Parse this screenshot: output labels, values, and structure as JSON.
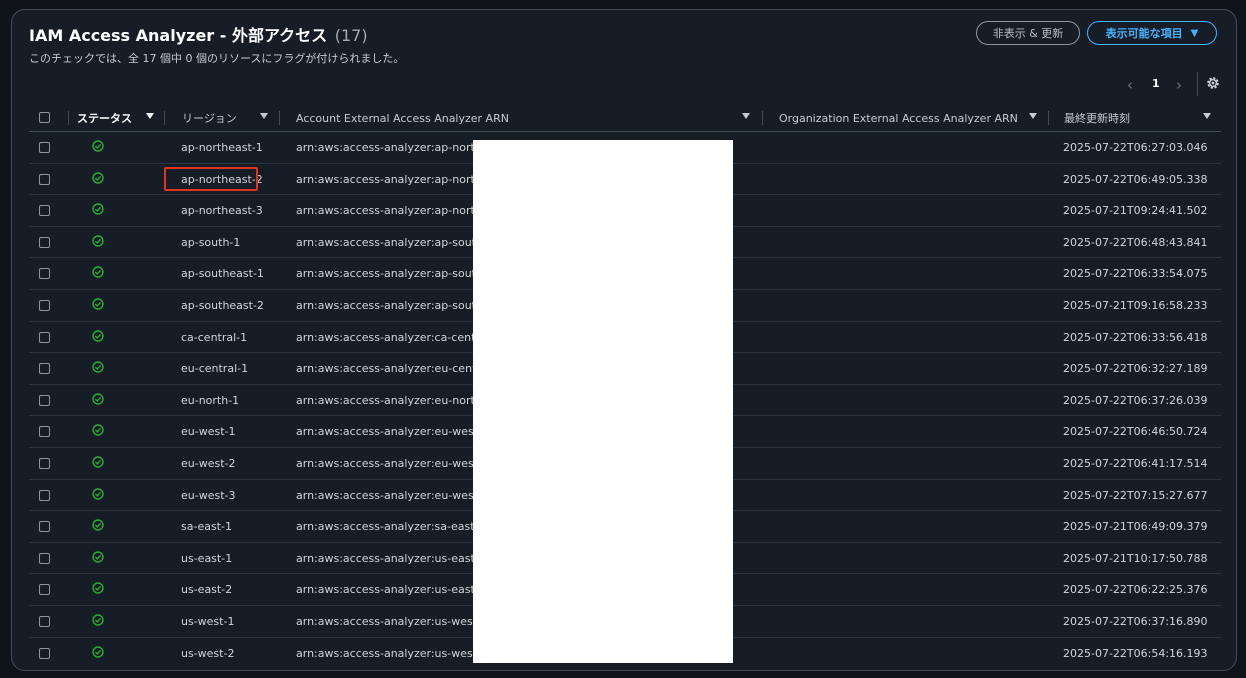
{
  "header": {
    "title": "IAM Access Analyzer - 外部アクセス",
    "count": "(17)",
    "subtitle": "このチェックでは、全 17 個中 0 個のリソースにフラグが付けられました。",
    "hide_button": "非表示 & 更新",
    "show_button": "表示可能な項目"
  },
  "pagination": {
    "current_page": "1"
  },
  "columns": {
    "status": "ステータス",
    "region": "リージョン",
    "account_arn": "Account External Access Analyzer ARN",
    "org_arn": "Organization External Access Analyzer ARN",
    "updated": "最終更新時刻"
  },
  "rows": [
    {
      "region": "ap-northeast-1",
      "arn": "arn:aws:access-analyzer:ap-northeast-1:",
      "updated": "2025-07-22T06:27:03.046"
    },
    {
      "region": "ap-northeast-2",
      "arn": "arn:aws:access-analyzer:ap-northeast-2:",
      "updated": "2025-07-22T06:49:05.338"
    },
    {
      "region": "ap-northeast-3",
      "arn": "arn:aws:access-analyzer:ap-northeast-3:",
      "updated": "2025-07-21T09:24:41.502"
    },
    {
      "region": "ap-south-1",
      "arn": "arn:aws:access-analyzer:ap-south-1:",
      "updated": "2025-07-22T06:48:43.841"
    },
    {
      "region": "ap-southeast-1",
      "arn": "arn:aws:access-analyzer:ap-southeast-1:",
      "updated": "2025-07-22T06:33:54.075"
    },
    {
      "region": "ap-southeast-2",
      "arn": "arn:aws:access-analyzer:ap-southeast-2:",
      "updated": "2025-07-21T09:16:58.233"
    },
    {
      "region": "ca-central-1",
      "arn": "arn:aws:access-analyzer:ca-central-1:",
      "updated": "2025-07-22T06:33:56.418"
    },
    {
      "region": "eu-central-1",
      "arn": "arn:aws:access-analyzer:eu-central-1:",
      "updated": "2025-07-22T06:32:27.189"
    },
    {
      "region": "eu-north-1",
      "arn": "arn:aws:access-analyzer:eu-north-1:",
      "updated": "2025-07-22T06:37:26.039"
    },
    {
      "region": "eu-west-1",
      "arn": "arn:aws:access-analyzer:eu-west-1:",
      "updated": "2025-07-22T06:46:50.724"
    },
    {
      "region": "eu-west-2",
      "arn": "arn:aws:access-analyzer:eu-west-2:",
      "updated": "2025-07-22T06:41:17.514"
    },
    {
      "region": "eu-west-3",
      "arn": "arn:aws:access-analyzer:eu-west-3:",
      "updated": "2025-07-22T07:15:27.677"
    },
    {
      "region": "sa-east-1",
      "arn": "arn:aws:access-analyzer:sa-east-1:1",
      "updated": "2025-07-21T06:49:09.379"
    },
    {
      "region": "us-east-1",
      "arn": "arn:aws:access-analyzer:us-east-1:1",
      "updated": "2025-07-21T10:17:50.788"
    },
    {
      "region": "us-east-2",
      "arn": "arn:aws:access-analyzer:us-east-2:1",
      "updated": "2025-07-22T06:22:25.376"
    },
    {
      "region": "us-west-1",
      "arn": "arn:aws:access-analyzer:us-west-1:",
      "updated": "2025-07-22T06:37:16.890"
    },
    {
      "region": "us-west-2",
      "arn": "arn:aws:access-analyzer:us-west-2:",
      "updated": "2025-07-22T06:54:16.193"
    }
  ],
  "colors": {
    "accent": "#42b4ff",
    "ok": "#29ad32",
    "highlight": "#e0341f"
  }
}
